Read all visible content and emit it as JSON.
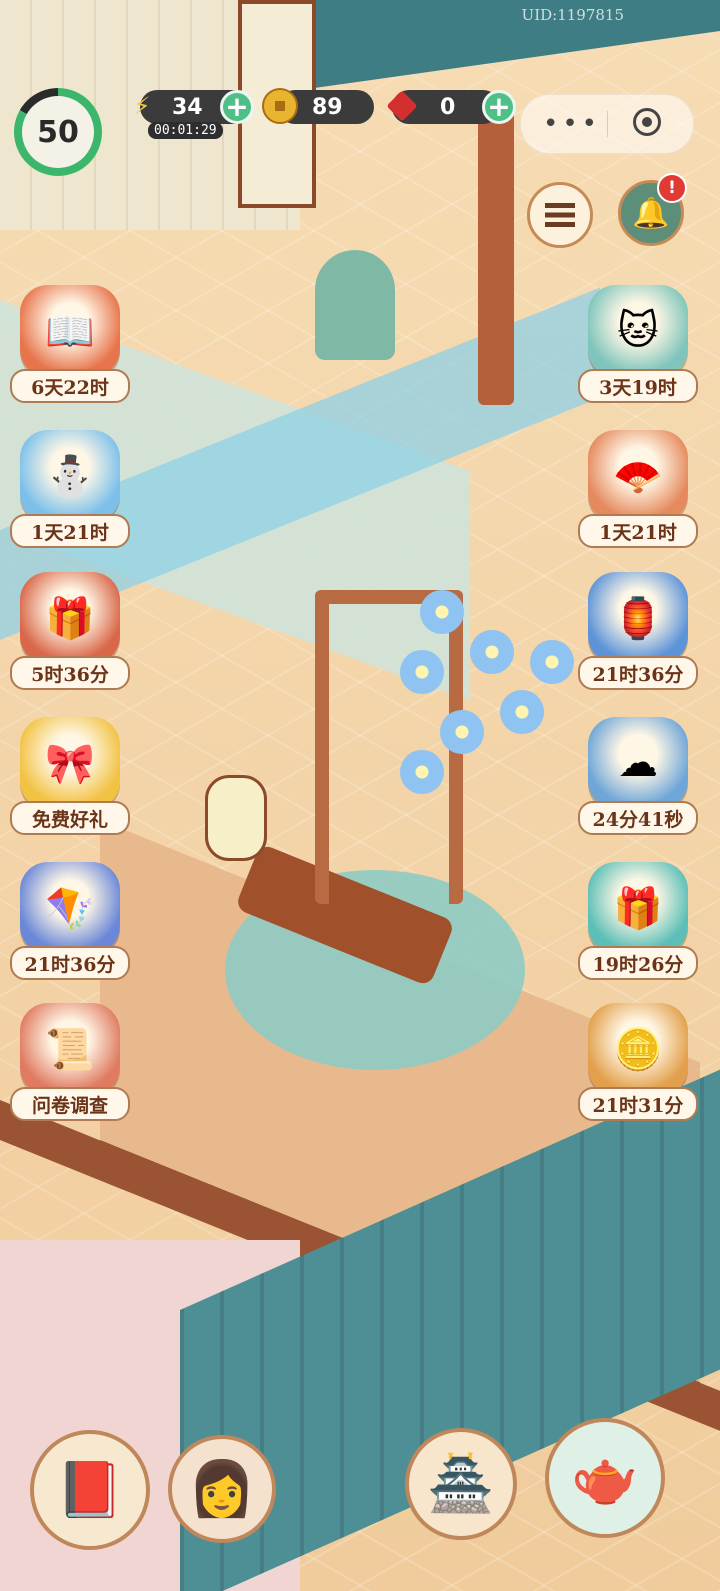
{
  "hud": {
    "uid": "UID:1197815",
    "level": "50",
    "energy": {
      "icon": "lightning-icon",
      "value": "34",
      "timer": "00:01:29"
    },
    "coins": {
      "icon": "coin-icon",
      "value": "89"
    },
    "gems": {
      "icon": "ruby-icon",
      "value": "0"
    },
    "miniprogram_capsule": {
      "more": "•••"
    }
  },
  "side_buttons": {
    "menu_icon": "list-icon",
    "shrine_icon": "gong-icon",
    "shrine_alert": "!"
  },
  "left_events": [
    {
      "name": "event-book-autumn",
      "label": "6天22时",
      "color": "#e7744b",
      "glyph": "📖"
    },
    {
      "name": "event-snow-cat",
      "label": "1天21时",
      "color": "#7cc0ea",
      "glyph": "⛄"
    },
    {
      "name": "event-treasure-chest",
      "label": "5时36分",
      "color": "#d9684a",
      "glyph": "🎁"
    },
    {
      "name": "event-free-gift",
      "label": "免费好礼",
      "color": "#f2c243",
      "glyph": "🎀"
    },
    {
      "name": "event-kite",
      "label": "21时36分",
      "color": "#6b88d8",
      "glyph": "🪁"
    },
    {
      "name": "event-survey",
      "label": "问卷调查",
      "color": "#e07b62",
      "glyph": "📜"
    }
  ],
  "right_events": [
    {
      "name": "event-cat-spa",
      "label": "3天19时",
      "color": "#7fc5bb",
      "glyph": "🐱"
    },
    {
      "name": "event-fan-cat",
      "label": "1天21时",
      "color": "#e58a5e",
      "glyph": "🪭"
    },
    {
      "name": "event-red-fan",
      "label": "21时36分",
      "color": "#5d94d8",
      "glyph": "🏮"
    },
    {
      "name": "event-cloud-map",
      "label": "24分41秒",
      "color": "#6fa6d8",
      "glyph": "☁"
    },
    {
      "name": "event-gift-box",
      "label": "19时26分",
      "color": "#5cbfb7",
      "glyph": "🎁"
    },
    {
      "name": "event-coin-board",
      "label": "21时31分",
      "color": "#e2a04c",
      "glyph": "🪙"
    }
  ],
  "bottom_nav": [
    {
      "name": "book-button",
      "icon": "red-book-icon",
      "glyph": "📕"
    },
    {
      "name": "character-button",
      "icon": "character-portrait-icon",
      "glyph": "👩"
    },
    {
      "name": "shop-building-button",
      "icon": "pavilion-icon",
      "glyph": "🏯"
    },
    {
      "name": "teapot-button",
      "icon": "teapot-icon",
      "glyph": "🫖"
    }
  ]
}
